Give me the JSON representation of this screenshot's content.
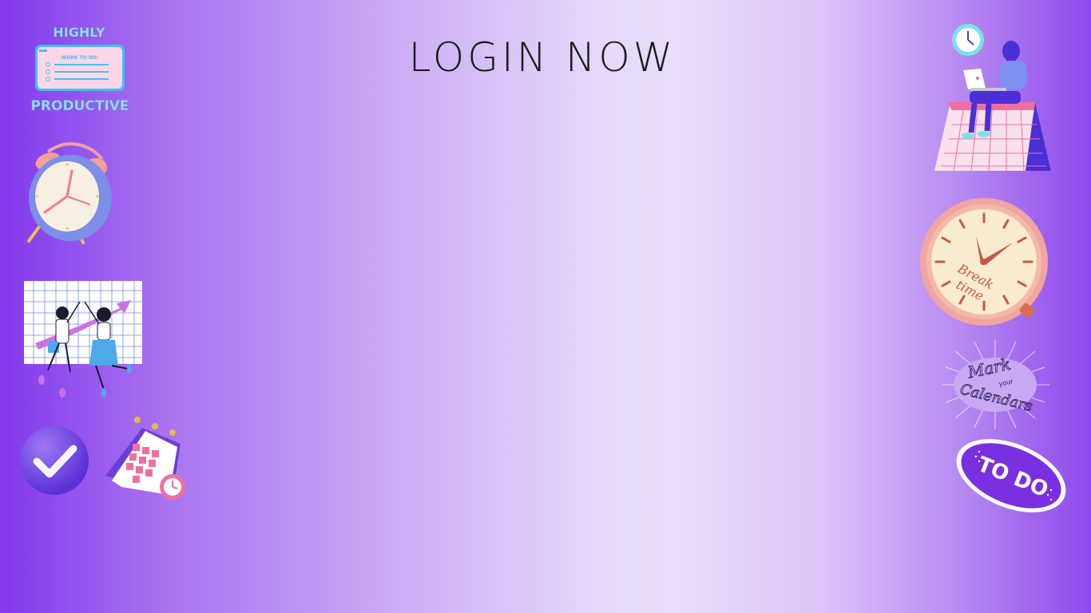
{
  "page": {
    "title": "LOGIN NOW"
  },
  "stickers": {
    "productive": {
      "top_text": "HIGHLY",
      "bottom_text": "PRODUCTIVE",
      "card_text": "WORK TO DO:"
    },
    "break_time_clock": {
      "text_line1": "Break",
      "text_line2": "time"
    },
    "mark_calendars": {
      "line1": "Mark",
      "line2": "your",
      "line3": "Calendars"
    },
    "todo_badge": {
      "text": "TO DO"
    }
  },
  "colors": {
    "accent_purple": "#8338ec",
    "pink": "#f06fa0",
    "light_blue": "#7fd4f5",
    "title_text": "#1a1a1a"
  }
}
